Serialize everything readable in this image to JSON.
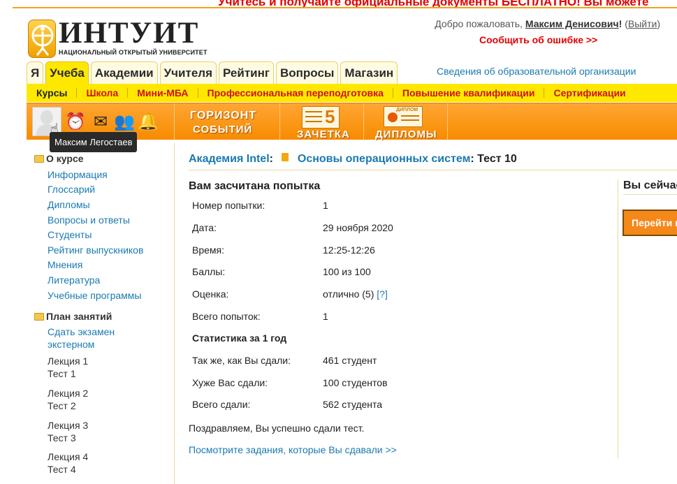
{
  "promo": {
    "text": "Учитесь и получайте официальные документы БЕСПЛАТНО! Вы можете"
  },
  "header": {
    "logo_title": "ИНТУИТ",
    "logo_subtitle": "НАЦИОНАЛЬНЫЙ ОТКРЫТЫЙ УНИВЕРСИТЕТ",
    "welcome_prefix": "Добро пожаловать,",
    "user_name": "Максим Денисович",
    "exclaim": "!",
    "logout_open": "(",
    "logout": "Выйти",
    "logout_close": ")",
    "report_error": "Сообщить об ошибке >>"
  },
  "tabs": [
    "Я",
    "Учеба",
    "Академии",
    "Учителя",
    "Рейтинг",
    "Вопросы",
    "Магазин"
  ],
  "active_tab": "Учеба",
  "org_info_link": "Сведения об образовательной организации",
  "subnav": [
    "Курсы",
    "Школа",
    "Мини-МБА",
    "Профессиональная переподготовка",
    "Повышение квалификации",
    "Сертификации"
  ],
  "iconbar": {
    "horizon_line1": "ГОРИЗОНТ",
    "horizon_line2": "СОБЫТИЙ",
    "zachetka": "ЗАЧЕТКА",
    "diplomas": "ДИПЛОМЫ",
    "diploma_badge": "ДИПЛОМ",
    "grade_digit": "5"
  },
  "tooltip": "Максим Легостаев",
  "sidebar": {
    "about_title": "О курсе",
    "about_links": [
      "Информация",
      "Глоссарий",
      "Дипломы",
      "Вопросы и ответы",
      "Студенты",
      "Рейтинг выпускников",
      "Мнения",
      "Литература",
      "Учебные программы"
    ],
    "plan_title": "План занятий",
    "exam_line1": "Сдать экзамен",
    "exam_line2": "экстерном",
    "lessons": [
      {
        "lecture": "Лекция 1",
        "test": "Тест 1"
      },
      {
        "lecture": "Лекция 2",
        "test": "Тест 2"
      },
      {
        "lecture": "Лекция 3",
        "test": "Тест 3"
      },
      {
        "lecture": "Лекция 4",
        "test": "Тест 4"
      }
    ]
  },
  "breadcrumb": {
    "academy": "Академия Intel",
    "colon": ":",
    "course": "Основы операционных систем",
    "current": ": Тест 10"
  },
  "result": {
    "title": "Вам засчитана попытка",
    "rows": [
      {
        "label": "Номер попытки:",
        "value": "1"
      },
      {
        "label": "Дата:",
        "value": "29 ноября 2020"
      },
      {
        "label": "Время:",
        "value": "12:25-12:26"
      },
      {
        "label": "Баллы:",
        "value": "100 из 100"
      },
      {
        "label": "Оценка:",
        "value": "отлично (5)"
      },
      {
        "label": "Всего попыток:",
        "value": "1"
      }
    ],
    "help_link": "[?]",
    "stats_title": "Статистика за 1 год",
    "stats": [
      {
        "label": "Так же, как Вы сдали:",
        "value": "461 студент"
      },
      {
        "label": "Хуже Вас сдали:",
        "value": "100 студентов"
      },
      {
        "label": "Всего сдали:",
        "value": "562 студента"
      }
    ],
    "congrats": "Поздравляем, Вы успешно сдали тест.",
    "tasks_link": "Посмотрите задания, которые Вы сдавали >>"
  },
  "right_panel": {
    "text": "Вы сейчас",
    "button": "Перейти к"
  }
}
